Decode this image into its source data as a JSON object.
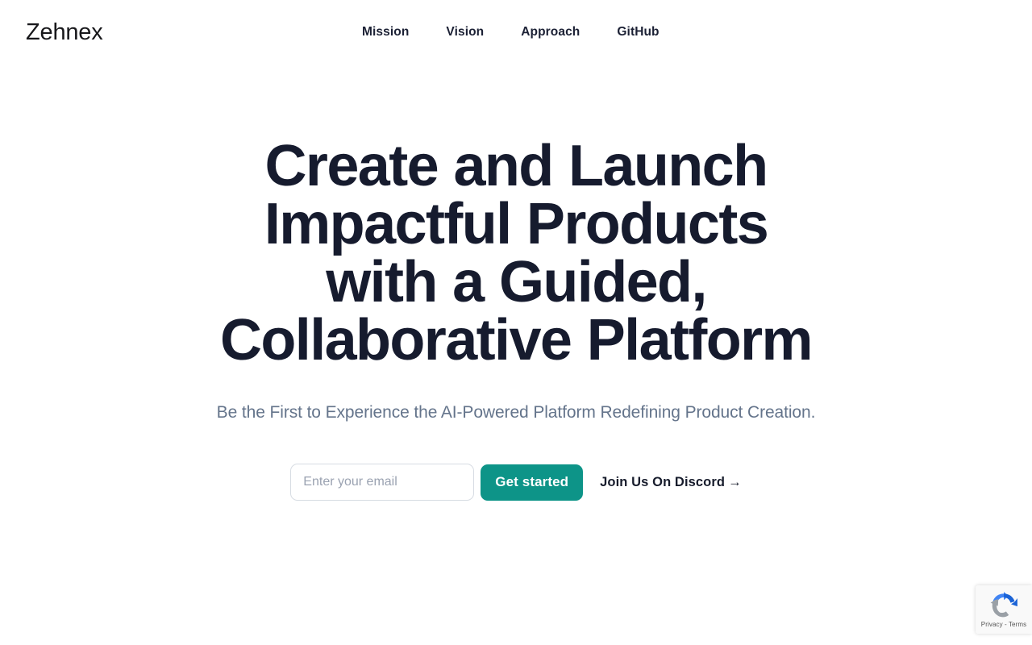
{
  "header": {
    "brand": "Zehnex",
    "nav": [
      {
        "label": "Mission",
        "name": "nav-link-mission"
      },
      {
        "label": "Vision",
        "name": "nav-link-vision"
      },
      {
        "label": "Approach",
        "name": "nav-link-approach"
      },
      {
        "label": "GitHub",
        "name": "nav-link-github"
      }
    ]
  },
  "hero": {
    "title": "Create and Launch Impactful Products with a Guided, Collaborative Platform",
    "title_lines": [
      "Create and Launch",
      "Impactful Products",
      "with a Guided,",
      "Collaborative Platform"
    ],
    "subtitle": "Be the First to Experience the AI-Powered Platform Redefining Product Creation."
  },
  "cta": {
    "email_placeholder": "Enter your email",
    "email_value": "",
    "primary_button": "Get started",
    "secondary_link": "Join Us On Discord",
    "secondary_link_arrow": "→"
  },
  "recaptcha": {
    "privacy_terms": "Privacy - Terms",
    "icon": "recaptcha-logo"
  },
  "colors": {
    "accent_teal": "#0d9488",
    "heading_navy": "#161b2e",
    "nav_navy": "#1b2034",
    "subtitle_gray": "#64748b",
    "brand_black": "#18181b",
    "input_border": "#d7dce3",
    "placeholder_gray": "#9aa2b1",
    "page_background": "#ffffff",
    "recaptcha_blue": "#4285f4",
    "recaptcha_blue_dark": "#1b63d6",
    "recaptcha_gray": "#9aa0a6",
    "recaptcha_bg": "#f9f9f9"
  }
}
